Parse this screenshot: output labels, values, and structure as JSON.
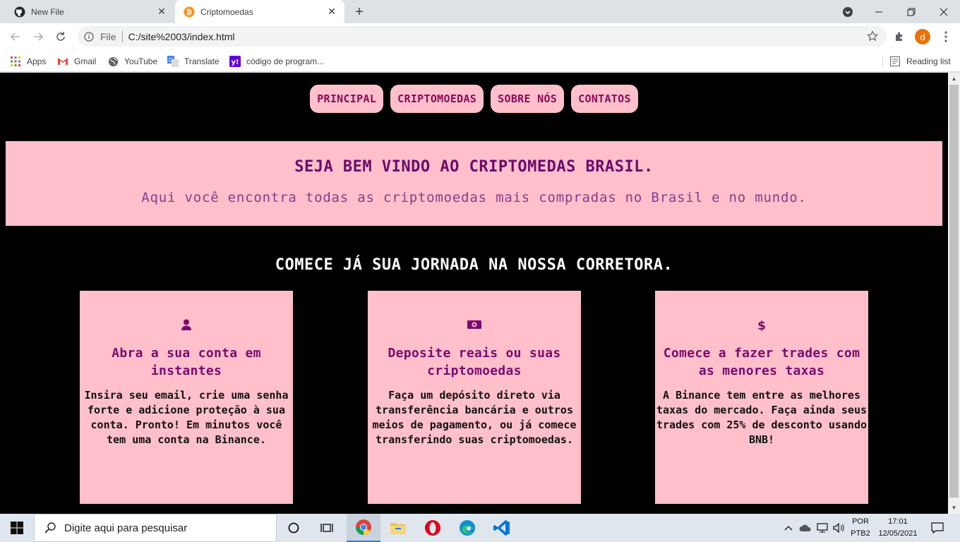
{
  "browser": {
    "tabs": [
      {
        "title": "New File",
        "active": false,
        "icon": "github-icon"
      },
      {
        "title": "Criptomoedas",
        "active": true,
        "icon": "bitcoin-icon"
      }
    ],
    "url": {
      "scheme": "File",
      "path": "C:/site%2003/index.html"
    },
    "profile_initial": "d",
    "bookmarks": [
      {
        "label": "Apps",
        "icon": "apps-grid-icon"
      },
      {
        "label": "Gmail",
        "icon": "gmail-icon"
      },
      {
        "label": "YouTube",
        "icon": "globe-icon"
      },
      {
        "label": "Translate",
        "icon": "translate-icon"
      },
      {
        "label": "código de program...",
        "icon": "yahoo-icon"
      }
    ],
    "reading_list": "Reading list"
  },
  "page": {
    "nav": [
      "PRINCIPAL",
      "CRIPTOMOEDAS",
      "SOBRE NÓS",
      "CONTATOS"
    ],
    "hero": {
      "title": "SEJA BEM VINDO AO CRIPTOMEDAS BRASIL.",
      "subtitle": "Aqui você encontra todas as criptomoedas mais compradas no Brasil e no mundo."
    },
    "cta_title": "COMECE JÁ SUA JORNADA NA NOSSA CORRETORA.",
    "cards": [
      {
        "icon": "user-icon",
        "title": "Abra a sua conta em instantes",
        "text": "Insira seu email, crie uma senha forte e adicione proteção à sua conta. Pronto! Em minutos você tem uma conta na Binance."
      },
      {
        "icon": "money-bill-icon",
        "title": "Deposite reais ou suas criptomoedas",
        "text": "Faça um depósito direto via transferência bancária e outros meios de pagamento, ou já comece transferindo suas criptomoedas."
      },
      {
        "icon": "dollar-icon",
        "title": "Comece a fazer trades com as menores taxas",
        "text": "A Binance tem entre as melhores taxas do mercado. Faça ainda seus trades com 25% de desconto usando BNB!"
      }
    ],
    "colors": {
      "pink": "#ffc0cb",
      "purple": "#7a0a6e",
      "background": "#000000"
    }
  },
  "taskbar": {
    "search_placeholder": "Digite aqui para pesquisar",
    "lang_line1": "POR",
    "lang_line2": "PTB2",
    "time": "17:01",
    "date": "12/05/2021"
  }
}
